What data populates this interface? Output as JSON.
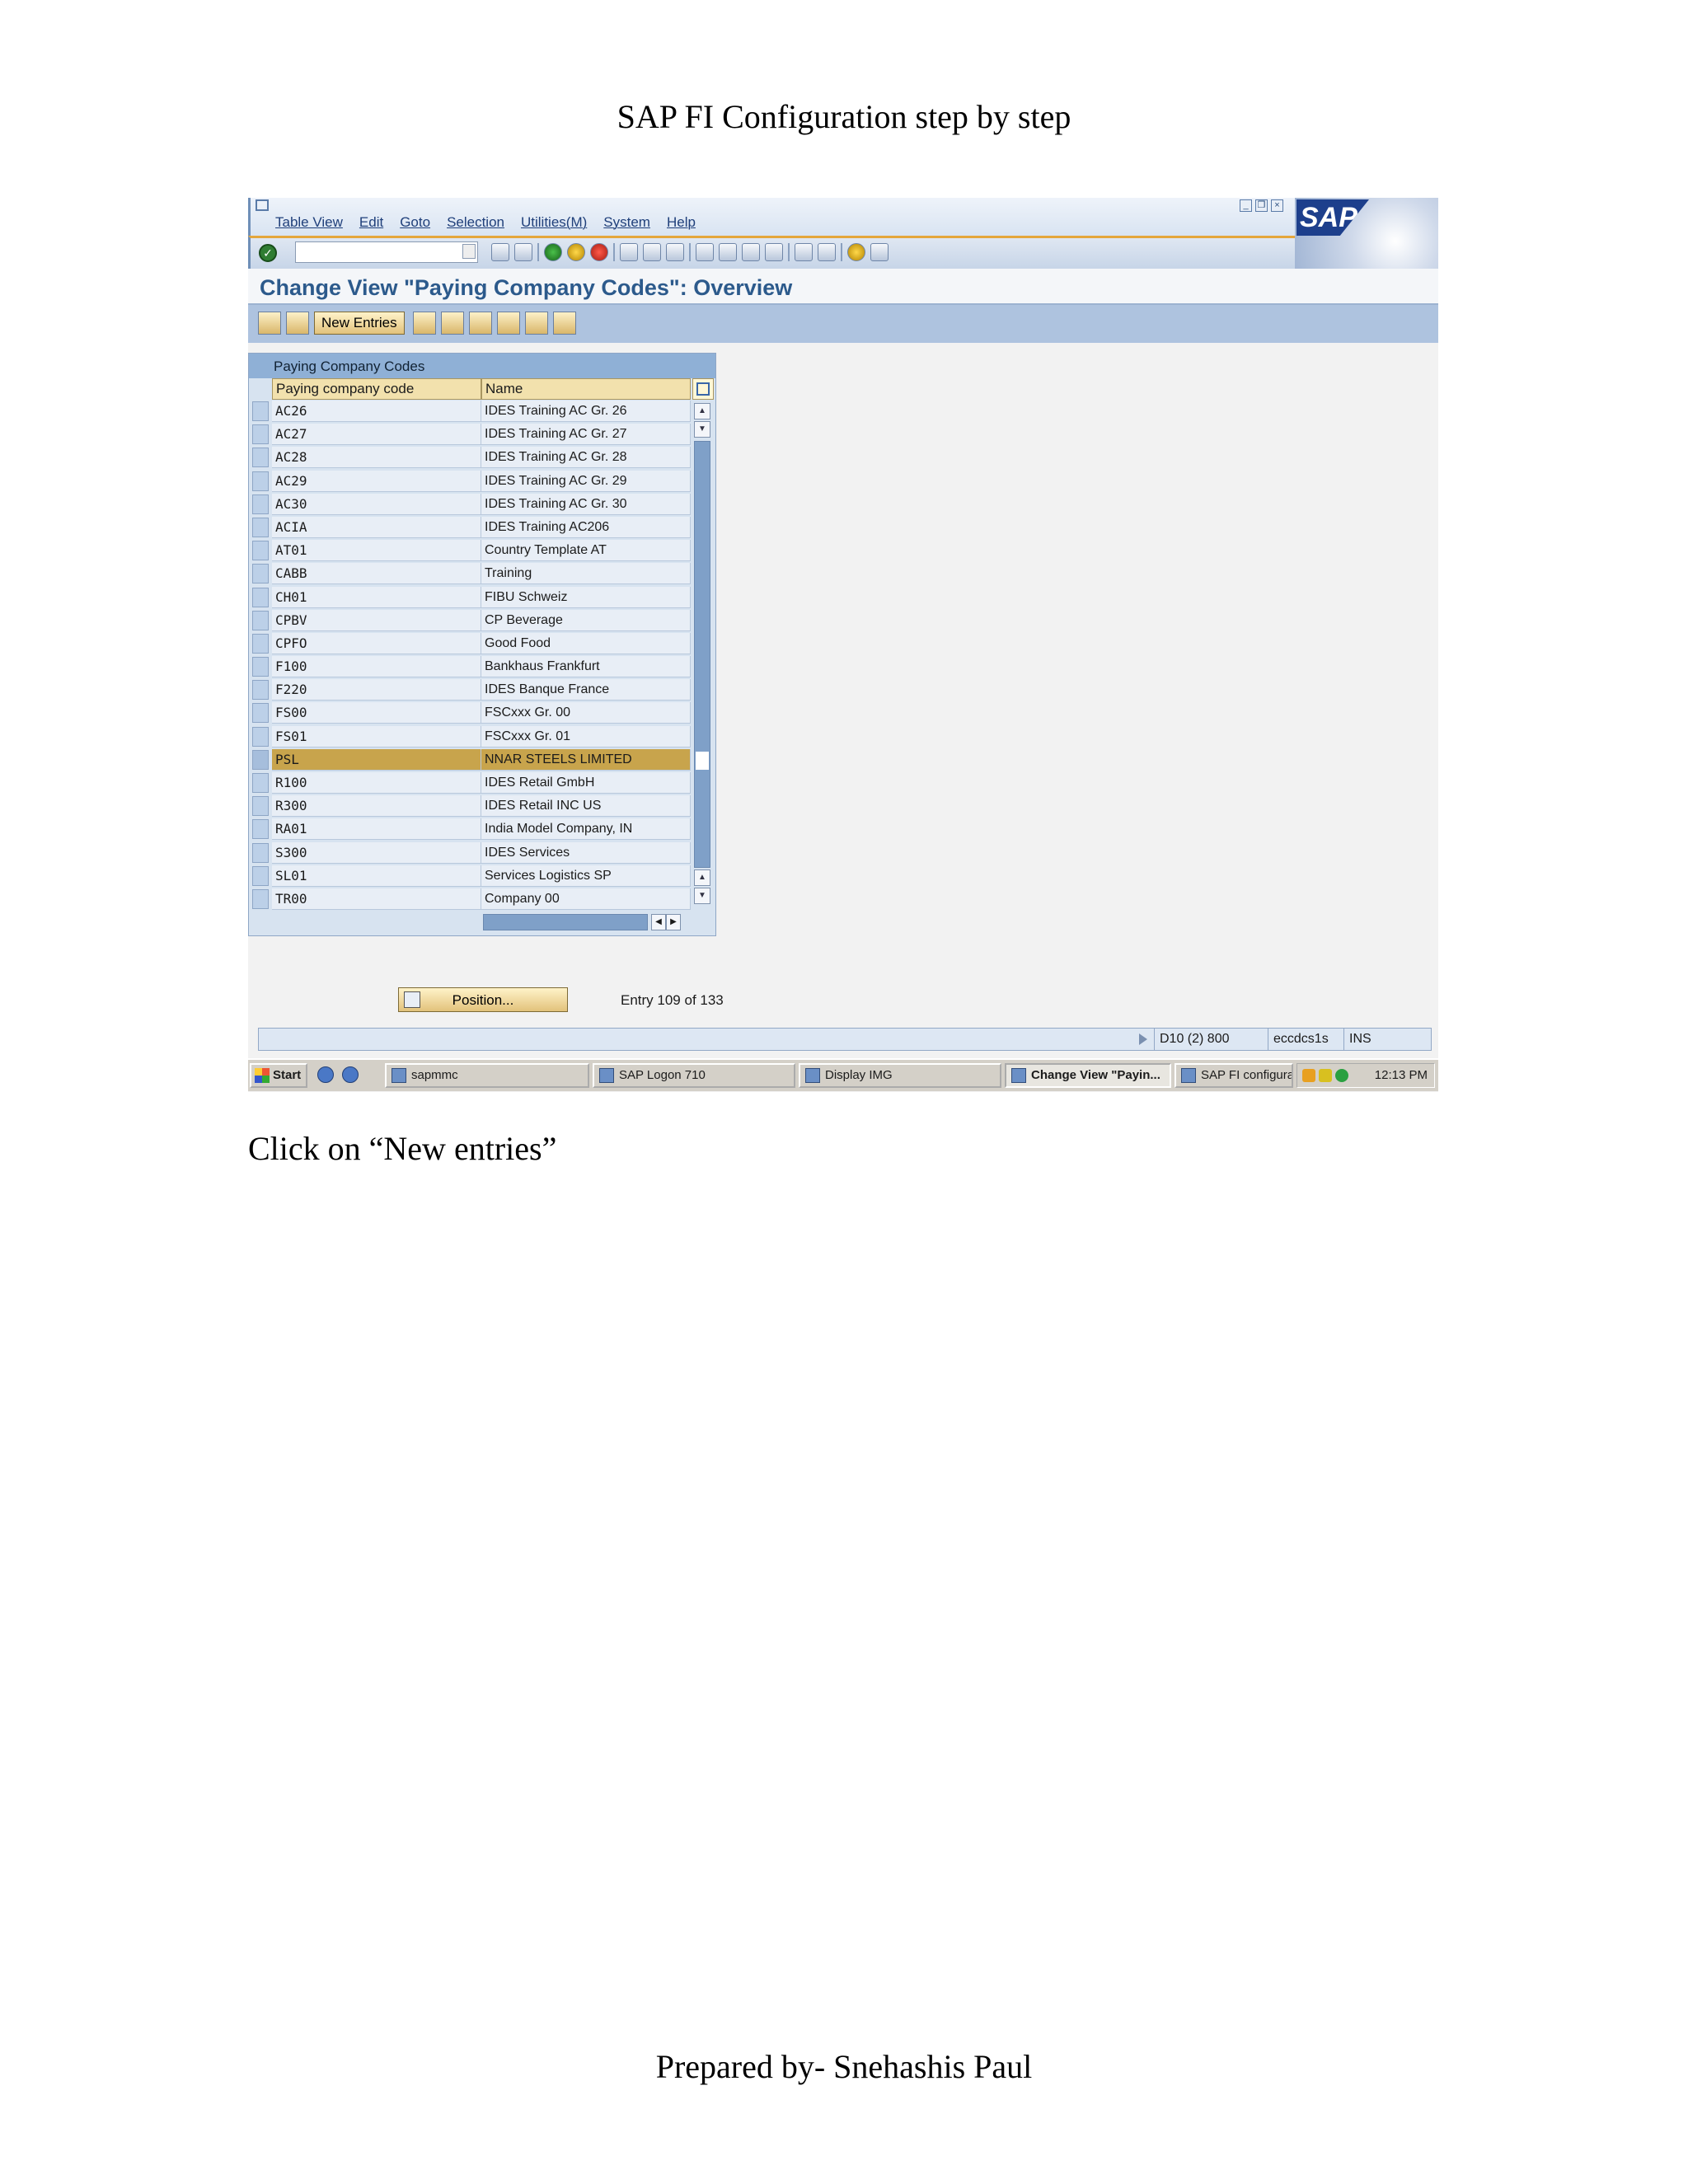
{
  "document": {
    "title": "SAP FI Configuration step by step",
    "instruction": "Click on “New entries”",
    "footer": "Prepared by- Snehashis Paul"
  },
  "sap": {
    "menu": [
      "Table View",
      "Edit",
      "Goto",
      "Selection",
      "Utilities(M)",
      "System",
      "Help"
    ],
    "logo_text": "SAP",
    "page_title": "Change View \"Paying Company Codes\": Overview",
    "new_entries_label": "New Entries",
    "table": {
      "caption": "Paying Company Codes",
      "columns": [
        "Paying company code",
        "Name"
      ],
      "rows": [
        {
          "code": "AC26",
          "name": "IDES Training AC Gr. 26"
        },
        {
          "code": "AC27",
          "name": "IDES Training AC Gr. 27"
        },
        {
          "code": "AC28",
          "name": "IDES Training AC Gr. 28"
        },
        {
          "code": "AC29",
          "name": "IDES Training AC Gr. 29"
        },
        {
          "code": "AC30",
          "name": "IDES Training AC Gr. 30"
        },
        {
          "code": "ACIA",
          "name": "IDES Training AC206"
        },
        {
          "code": "AT01",
          "name": "Country Template AT"
        },
        {
          "code": "CABB",
          "name": "Training"
        },
        {
          "code": "CH01",
          "name": "FIBU Schweiz"
        },
        {
          "code": "CPBV",
          "name": "CP Beverage"
        },
        {
          "code": "CPFO",
          "name": "Good Food"
        },
        {
          "code": "F100",
          "name": "Bankhaus Frankfurt"
        },
        {
          "code": "F220",
          "name": "IDES  Banque France"
        },
        {
          "code": "FS00",
          "name": "FSCxxx Gr. 00"
        },
        {
          "code": "FS01",
          "name": "FSCxxx Gr. 01"
        },
        {
          "code": "PSL",
          "name": "NNAR STEELS LIMITED",
          "selected": true
        },
        {
          "code": "R100",
          "name": "IDES Retail GmbH"
        },
        {
          "code": "R300",
          "name": "IDES Retail INC US"
        },
        {
          "code": "RA01",
          "name": "India Model Company, IN"
        },
        {
          "code": "S300",
          "name": "IDES Services"
        },
        {
          "code": "SL01",
          "name": "Services Logistics SP"
        },
        {
          "code": "TR00",
          "name": "Company 00"
        }
      ]
    },
    "position_label": "Position...",
    "entry_text": "Entry 109 of 133",
    "status": {
      "system": "D10 (2) 800",
      "server": "eccdcs1s",
      "mode": "INS"
    },
    "taskbar": {
      "start": "Start",
      "items": [
        {
          "label": "sapmmc",
          "active": false
        },
        {
          "label": "SAP Logon 710",
          "active": false
        },
        {
          "label": "Display IMG",
          "active": false
        },
        {
          "label": "Change View \"Payin...",
          "active": true
        },
        {
          "label": "SAP FI configuration c...",
          "active": false
        }
      ],
      "clock": "12:13 PM"
    }
  }
}
